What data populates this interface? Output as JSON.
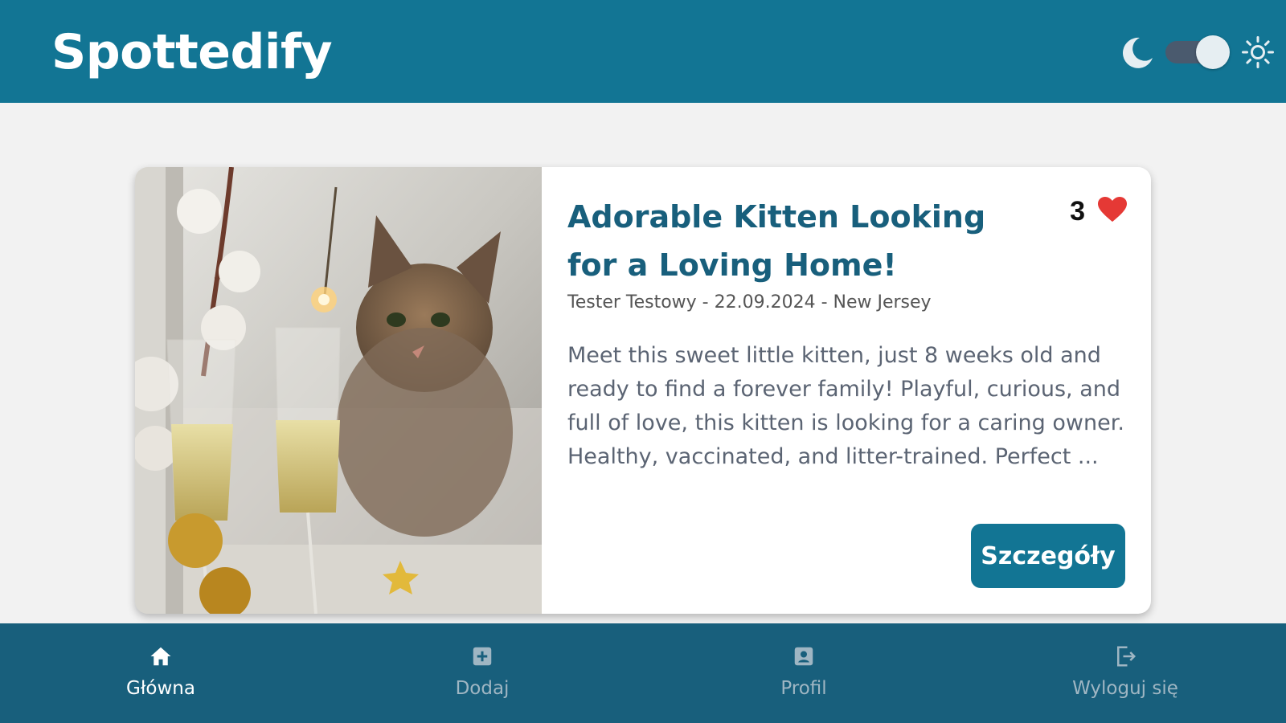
{
  "header": {
    "app_title": "Spottedify",
    "theme_toggle": {
      "left_icon": "moon-icon",
      "right_icon": "sun-icon",
      "state": "light"
    }
  },
  "post": {
    "image": "kitten-behind-frosted-window-photo",
    "title": "Adorable Kitten Looking for a Loving Home!",
    "likes": "3",
    "like_icon": "heart-icon",
    "meta": "Tester Testowy - 22.09.2024 - New Jersey",
    "description": "Meet this sweet little kitten, just 8 weeks old and ready to find a forever family! Playful, curious, and full of love, this kitten is looking for a caring owner. Healthy, vaccinated, and litter-trained. Perfect ...",
    "details_button": "Szczegóły"
  },
  "bottom_nav": {
    "items": [
      {
        "label": "Główna",
        "icon": "home-icon",
        "active": true
      },
      {
        "label": "Dodaj",
        "icon": "add-square-icon",
        "active": false
      },
      {
        "label": "Profil",
        "icon": "profile-card-icon",
        "active": false
      },
      {
        "label": "Wyloguj się",
        "icon": "logout-icon",
        "active": false
      }
    ]
  },
  "colors": {
    "primary": "#127594",
    "nav_bg": "#185f7c",
    "heart": "#e53935",
    "background": "#f2f2f2"
  }
}
